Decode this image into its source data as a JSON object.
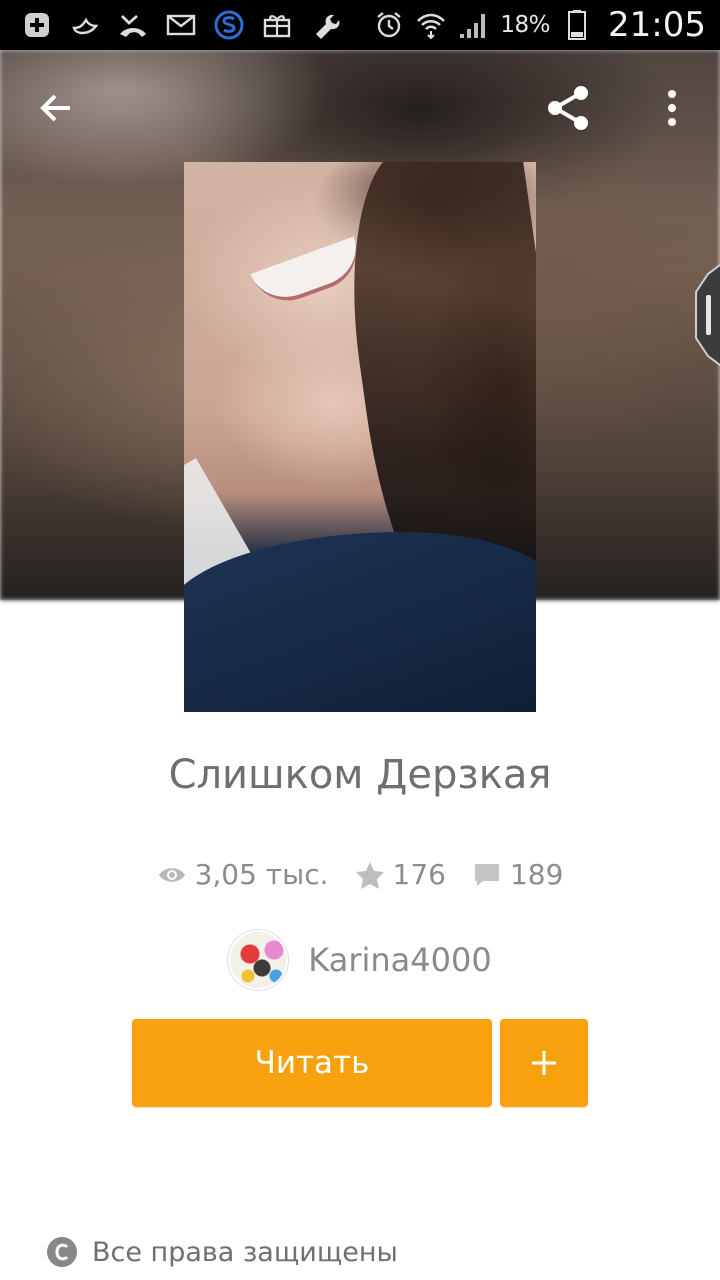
{
  "status_bar": {
    "battery_pct": "18%",
    "time": "21:05"
  },
  "toolbar": {
    "back_icon": "arrow-left-icon",
    "share_icon": "share-icon",
    "more_icon": "more-vert-icon"
  },
  "story": {
    "title": "Слишком Дерзкая",
    "views": "3,05 тыс.",
    "votes": "176",
    "comments": "189",
    "author": "Karina4000"
  },
  "actions": {
    "read_label": "Читать",
    "add_label": "+"
  },
  "footer": {
    "rights_label": "Все права защищены"
  },
  "colors": {
    "accent": "#f7a10e",
    "text_muted": "#8c8c8c"
  }
}
